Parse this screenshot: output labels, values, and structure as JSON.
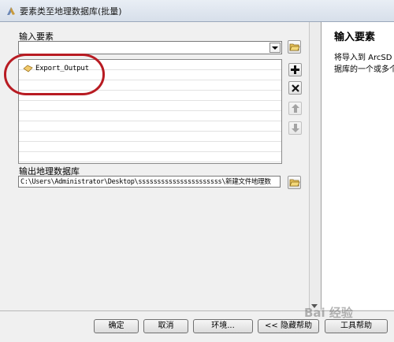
{
  "window": {
    "title": "要素类至地理数据库(批量)"
  },
  "input_features": {
    "label": "输入要素",
    "dropdown_value": "",
    "items": [
      "Export_Output"
    ]
  },
  "output_gdb": {
    "label": "输出地理数据库",
    "path": "C:\\Users\\Administrator\\Desktop\\ssssssssssssssssssssss\\新建文件地理数"
  },
  "buttons": {
    "ok": "确定",
    "cancel": "取消",
    "environments": "环境...",
    "hide_help": "<< 隐藏帮助",
    "tool_help": "工具帮助"
  },
  "help_panel": {
    "title": "输入要素",
    "line1": "将导入到 ArcSD",
    "line2": "据库的一个或多个"
  },
  "watermark": "Bai 经验",
  "colors": {
    "annotation": "#b81b22",
    "window_bg": "#f0f0f0"
  },
  "icons": {
    "app": "arctoolbox-icon",
    "browse": "folder-open-icon",
    "add": "plus-icon",
    "remove": "x-icon",
    "up": "arrow-up-icon",
    "down": "arrow-down-icon",
    "feature": "polygon-feature-icon"
  }
}
